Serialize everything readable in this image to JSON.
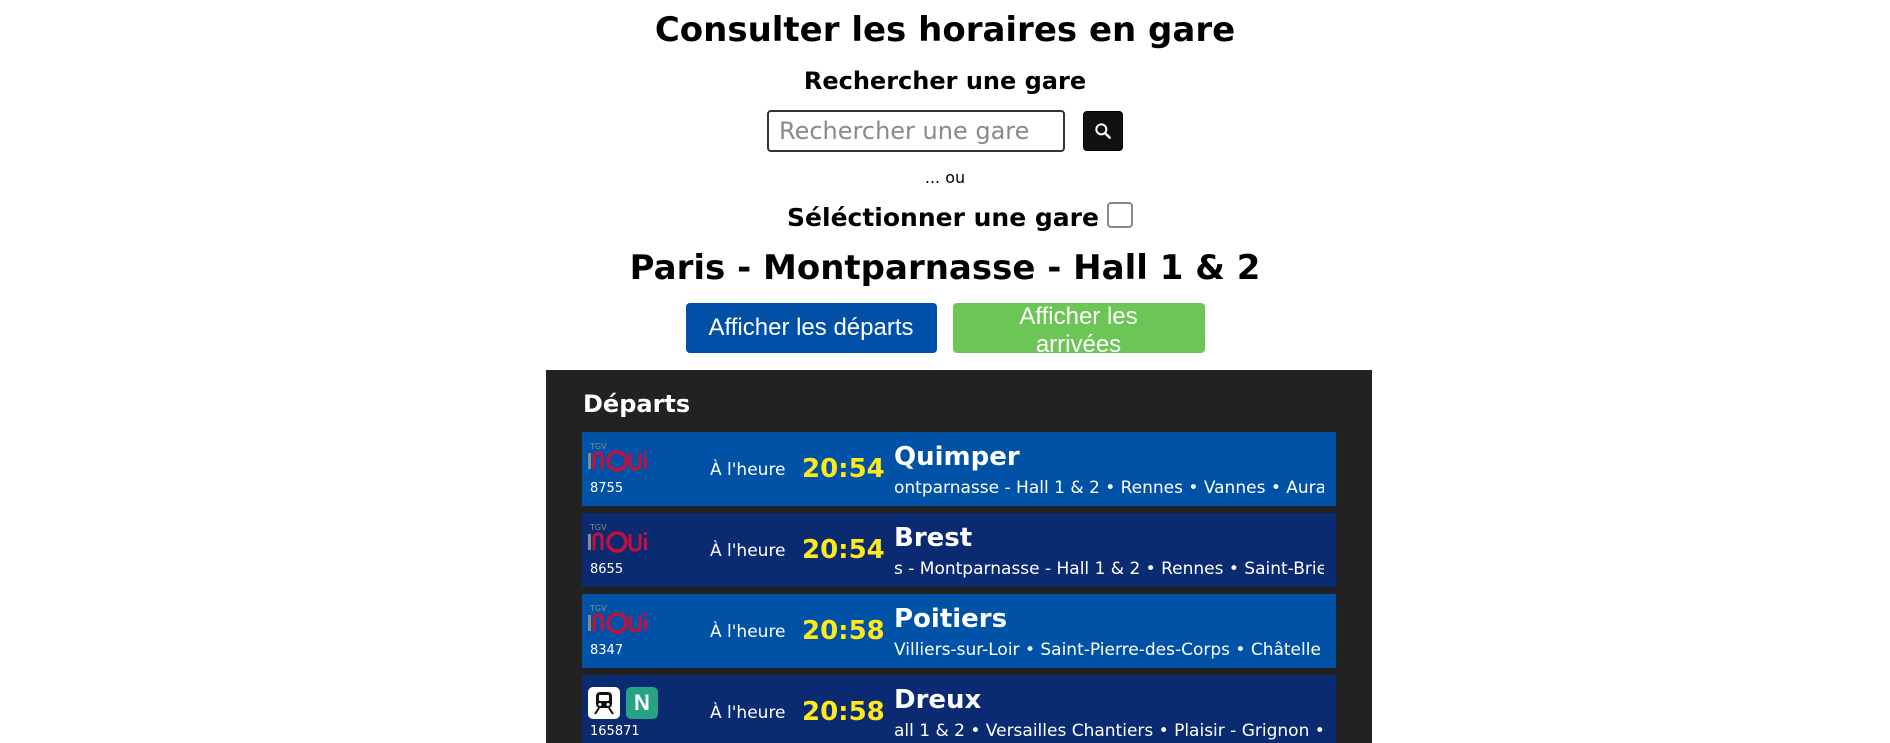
{
  "header": {
    "title": "Consulter les horaires en gare",
    "search_title": "Rechercher une gare",
    "or_text": "... ou",
    "select_label": "Séléctionner une gare"
  },
  "search": {
    "placeholder": "Rechercher une gare",
    "value": "",
    "button_icon": "search-icon"
  },
  "station": {
    "name": "Paris - Montparnasse - Hall 1 & 2"
  },
  "buttons": {
    "departures": "Afficher les départs",
    "arrivals": "Afficher les arrivées"
  },
  "colors": {
    "departures_button": "#0050a8",
    "arrivals_button": "#6cc655",
    "board_bg": "#222222",
    "row_light": "#0052a6",
    "row_dark": "#0a2a72",
    "time_color": "#ffe919",
    "inoui_red": "#c4103e"
  },
  "board": {
    "title": "Départs",
    "rows": [
      {
        "logo": "tgv-inoui-logo",
        "logo_small": "TGV",
        "train_number": "8755",
        "status": "À l'heure",
        "time": "20:54",
        "destination": "Quimper",
        "stops": "ontparnasse - Hall 1 & 2 • Rennes • Vannes • Aura"
      },
      {
        "logo": "tgv-inoui-logo",
        "logo_small": "TGV",
        "train_number": "8655",
        "status": "À l'heure",
        "time": "20:54",
        "destination": "Brest",
        "stops": "s - Montparnasse - Hall 1 & 2 • Rennes • Saint-Brie"
      },
      {
        "logo": "tgv-inoui-logo",
        "logo_small": "TGV",
        "train_number": "8347",
        "status": "À l'heure",
        "time": "20:58",
        "destination": "Poitiers",
        "stops": "Villiers-sur-Loir • Saint-Pierre-des-Corps • Châtelle"
      },
      {
        "logo": "transilien-n-logo",
        "logo_small": "N",
        "train_number": "165871",
        "status": "À l'heure",
        "time": "20:58",
        "destination": "Dreux",
        "stops": "all 1 & 2 • Versailles Chantiers • Plaisir - Grignon •"
      }
    ]
  }
}
